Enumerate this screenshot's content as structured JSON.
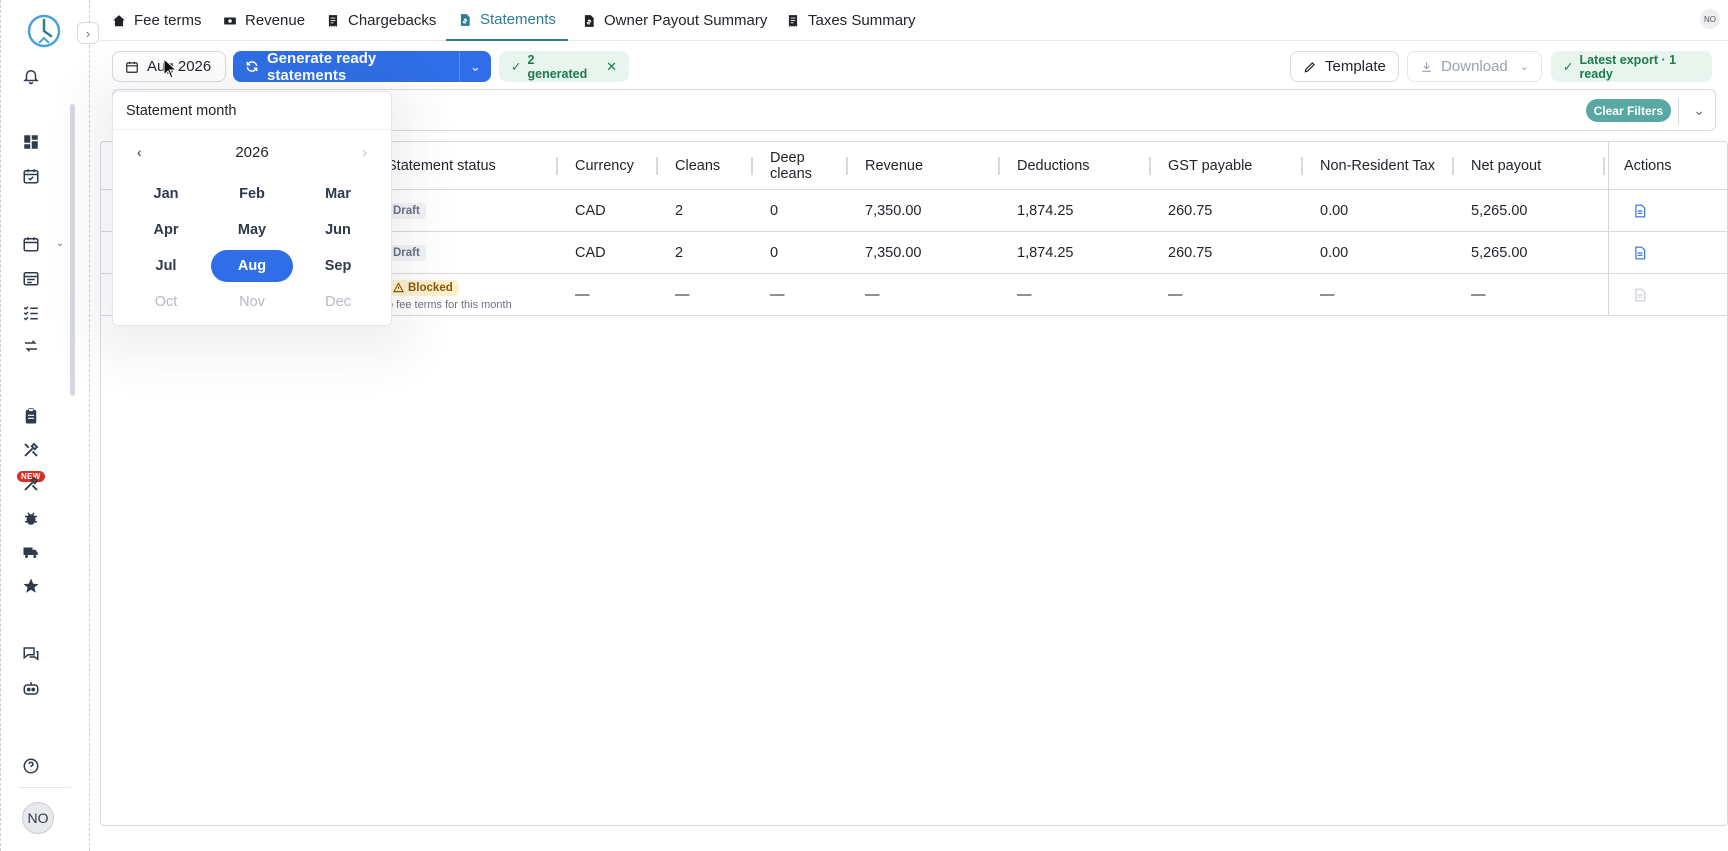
{
  "sidebar": {
    "new_badge": "NEW",
    "avatar_initials": "NO",
    "icons": [
      "logo-icon",
      "bell-icon",
      "dashboard-icon",
      "calendar-check-icon",
      "calendar-icon",
      "calendar-list-icon",
      "checklist-icon",
      "sync-icon",
      "clipboard-icon",
      "tools-icon",
      "tools-new-icon",
      "bug-icon",
      "truck-icon",
      "star-icon",
      "chat-icon",
      "robot-icon",
      "help-icon"
    ]
  },
  "tabs": [
    {
      "label": "Fee terms",
      "icon": "house-money-icon"
    },
    {
      "label": "Revenue",
      "icon": "money-icon"
    },
    {
      "label": "Chargebacks",
      "icon": "receipt-icon"
    },
    {
      "label": "Statements",
      "icon": "file-dollar-icon",
      "active": true
    },
    {
      "label": "Owner Payout Summary",
      "icon": "file-dollar-icon"
    },
    {
      "label": "Taxes Summary",
      "icon": "receipt-icon"
    }
  ],
  "top_avatar": "NO",
  "toolbar": {
    "month_button": "Aug 2026",
    "generate_label": "Generate ready statements",
    "generated_pill": "2 generated",
    "template_label": "Template",
    "download_label": "Download",
    "latest_export": "Latest export · 1 ready"
  },
  "filters": {
    "clear_label": "Clear Filters"
  },
  "table": {
    "headers": {
      "status": "Statement status",
      "currency": "Currency",
      "cleans": "Cleans",
      "deep_cleans": "Deep cleans",
      "revenue": "Revenue",
      "deductions": "Deductions",
      "gst": "GST payable",
      "nrt": "Non-Resident Tax",
      "net": "Net payout",
      "actions": "Actions"
    },
    "rows": [
      {
        "status": "Draft",
        "currency": "CAD",
        "cleans": "2",
        "deep": "0",
        "revenue": "7,350.00",
        "deductions": "1,874.25",
        "gst": "260.75",
        "nrt": "0.00",
        "net": "5,265.00"
      },
      {
        "status": "Draft",
        "currency": "CAD",
        "cleans": "2",
        "deep": "0",
        "revenue": "7,350.00",
        "deductions": "1,874.25",
        "gst": "260.75",
        "nrt": "0.00",
        "net": "5,265.00"
      },
      {
        "status": "Blocked",
        "note": "o fee terms for this month",
        "currency": "—",
        "cleans": "—",
        "deep": "—",
        "revenue": "—",
        "deductions": "—",
        "gst": "—",
        "nrt": "—",
        "net": "—"
      }
    ]
  },
  "picker": {
    "title": "Statement month",
    "year": "2026",
    "months": [
      "Jan",
      "Feb",
      "Mar",
      "Apr",
      "May",
      "Jun",
      "Jul",
      "Aug",
      "Sep",
      "Oct",
      "Nov",
      "Dec"
    ],
    "selected": "Aug",
    "disabled": [
      "Oct",
      "Nov",
      "Dec"
    ]
  },
  "colors": {
    "primary": "#2f6ee6",
    "tab_active": "#2e7d95",
    "success": "#1f7a4a",
    "filter_chip": "#5aa8a3"
  }
}
